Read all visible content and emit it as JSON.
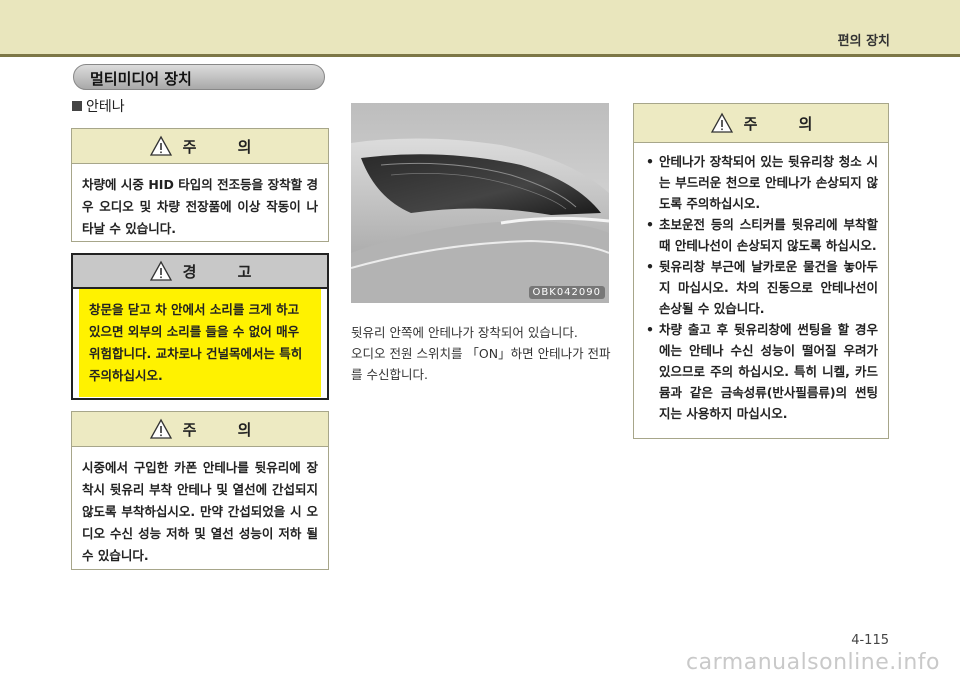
{
  "header": {
    "chapter_title": "편의 장치"
  },
  "section": {
    "title": "멀티미디어 장치"
  },
  "subsection": {
    "title": "안테나"
  },
  "notice_caution_1": {
    "label": "주 의",
    "text": "차량에 시중 HID 타입의 전조등을 장착할 경우 오디오 및 차량 전장품에 이상 작동이 나타날 수 있습니다."
  },
  "notice_warning": {
    "label": "경 고",
    "text": "창문을 닫고 차 안에서 소리를 크게 하고 있으면 외부의 소리를 들을 수 없어 매우 위험합니다. 교차로나 건널목에서는 특히 주의하십시오."
  },
  "notice_caution_2": {
    "label": "주 의",
    "text": "시중에서 구입한 카폰 안테나를 뒷유리에 장착시 뒷유리 부착 안테나 및 열선에 간섭되지 않도록 부착하십시오. 만약 간섭되었을 시 오디오 수신 성능 저하 및 열선 성능이 저하 될 수 있습니다."
  },
  "figure": {
    "code": "OBK042090"
  },
  "caption": {
    "line1": "뒷유리 안쪽에 안테나가 장착되어 있습니다.",
    "line2": "오디오 전원 스위치를 「ON」하면 안테나가 전파를 수신합니다."
  },
  "notice_caution_3": {
    "label": "주 의",
    "items": [
      "안테나가 장착되어 있는 뒷유리창 청소 시는 부드러운 천으로 안테나가 손상되지 않도록 주의하십시오.",
      "초보운전 등의 스티커를 뒷유리에 부착할 때 안테나선이 손상되지 않도록 하십시오.",
      "뒷유리창 부근에 날카로운 물건을 놓아두지 마십시오. 차의 진동으로 안테나선이 손상될 수 있습니다.",
      "차량 출고 후 뒷유리창에 썬팅을 할 경우에는 안테나 수신 성능이 떨어질 우려가 있으므로 주의 하십시오. 특히 니켈, 카드뮴과 같은 금속성류(반사필름류)의 썬팅지는 사용하지 마십시오."
    ]
  },
  "footer": {
    "page_number": "4-115",
    "watermark": "carmanualsonline.info"
  }
}
